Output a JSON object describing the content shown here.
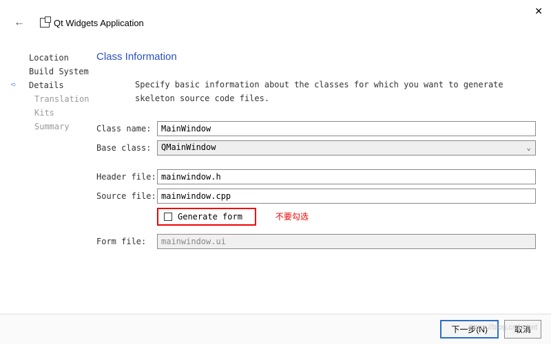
{
  "window": {
    "title": "Qt Widgets Application"
  },
  "nav": {
    "items": [
      {
        "label": "Location"
      },
      {
        "label": "Build System"
      },
      {
        "label": "Details"
      },
      {
        "label": "Translation"
      },
      {
        "label": "Kits"
      },
      {
        "label": "Summary"
      }
    ]
  },
  "main": {
    "section_title": "Class Information",
    "description": "Specify basic information about the classes for which you want to generate skeleton source code files.",
    "fields": {
      "class_name": {
        "label": "Class name:",
        "value": "MainWindow"
      },
      "base_class": {
        "label": "Base class:",
        "value": "QMainWindow"
      },
      "header_file": {
        "label": "Header file:",
        "value": "mainwindow.h"
      },
      "source_file": {
        "label": "Source file:",
        "value": "mainwindow.cpp"
      },
      "generate_form": {
        "label": "Generate form"
      },
      "form_file": {
        "label": "Form file:",
        "value": "mainwindow.ui"
      }
    },
    "annotation": "不要勾选"
  },
  "footer": {
    "next": "下一步(N)",
    "cancel": "取消"
  },
  "watermark": "https://blog.csdn.net"
}
